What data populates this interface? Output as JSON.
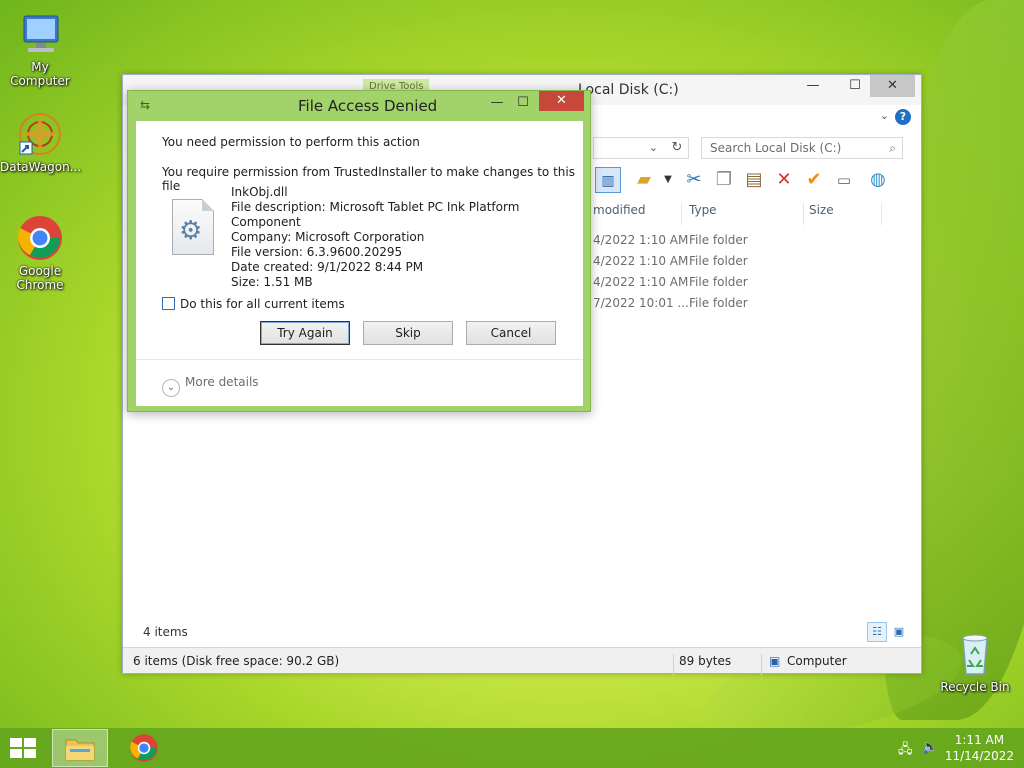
{
  "desktop": {
    "icons": [
      {
        "label": "My Computer"
      },
      {
        "label": "DataWagon..."
      },
      {
        "label": "Google Chrome"
      },
      {
        "label": "Recycle Bin"
      }
    ]
  },
  "explorer": {
    "title": "Local Disk (C:)",
    "ribbon_tab": "Drive Tools",
    "window_controls": {
      "minimize": "—",
      "maximize": "☐",
      "close": "✕"
    },
    "search_placeholder": "Search Local Disk (C:)",
    "columns": [
      "modified",
      "Type",
      "Size"
    ],
    "rows": [
      {
        "modified": "4/2022 1:10 AM",
        "type": "File folder"
      },
      {
        "modified": "4/2022 1:10 AM",
        "type": "File folder"
      },
      {
        "modified": "4/2022 1:10 AM",
        "type": "File folder"
      },
      {
        "modified": "7/2022 10:01 ...",
        "type": "File folder"
      }
    ],
    "items_count": "4 items",
    "status": {
      "left": "6 items (Disk free space: 90.2 GB)",
      "size": "89 bytes",
      "location": "Computer"
    }
  },
  "dialog": {
    "title": "File Access Denied",
    "line1": "You need permission to perform this action",
    "line2": "You require permission from TrustedInstaller to make changes to this file",
    "file": {
      "name": "InkObj.dll",
      "description": "File description: Microsoft Tablet PC Ink Platform Component",
      "company": "Company: Microsoft Corporation",
      "version": "File version: 6.3.9600.20295",
      "created": "Date created: 9/1/2022 8:44 PM",
      "size": "Size: 1.51 MB"
    },
    "checkbox_label": "Do this for all current items",
    "buttons": {
      "try_again": "Try Again",
      "skip": "Skip",
      "cancel": "Cancel"
    },
    "more_details": "More details",
    "controls": {
      "minimize": "—",
      "maximize": "☐",
      "close": "✕"
    }
  },
  "taskbar": {
    "time": "1:11 AM",
    "date": "11/14/2022"
  }
}
